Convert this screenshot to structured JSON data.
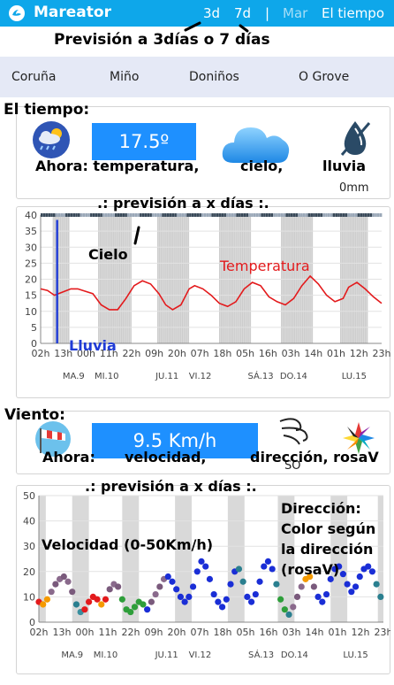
{
  "header": {
    "app_name": "Mareator",
    "nav": {
      "d3": "3d",
      "d7": "7d",
      "separator": "|",
      "mar": "Mar",
      "tiempo": "El tiempo"
    }
  },
  "annotations": {
    "forecast_note": "Previsión a 3días o 7 días",
    "weather_title": "El tiempo:",
    "weather_now": "Ahora: temperatura,",
    "weather_sky": "cielo,",
    "weather_rain": "lluvia",
    "forecast_days_1": ".: previsión a x días :.",
    "cielo": "Cielo",
    "temperatura": "Temperatura",
    "lluvia": "Lluvia",
    "wind_title": "Viento:",
    "wind_now": "Ahora:",
    "wind_speed": "velocidad,",
    "wind_dir": "dirección, rosaV",
    "forecast_days_2": ".: previsión a x días :.",
    "velocidad": "Velocidad (0-50Km/h)",
    "direccion_1": "Dirección:",
    "direccion_2": "Color según",
    "direccion_3": "la dirección",
    "direccion_4": "(rosaV)"
  },
  "locations": [
    "Coruña",
    "Miño",
    "Doniños",
    "O Grove"
  ],
  "weather_now": {
    "temperature": "17.5º",
    "rain": "0mm",
    "icons": [
      "partly-cloudy-rain-icon",
      "cloud-icon",
      "no-rain-drop-icon"
    ]
  },
  "wind_now": {
    "speed": "9.5 Km/h",
    "direction": "SO",
    "icons": [
      "windsock-icon",
      "wind-direction-icon",
      "wind-rose-icon"
    ]
  },
  "x_ticks": [
    "02h",
    "13h",
    "00h",
    "11h",
    "22h",
    "09h",
    "20h",
    "07h",
    "18h",
    "05h",
    "16h",
    "03h",
    "14h",
    "01h",
    "12h",
    "23h"
  ],
  "day_labels": [
    {
      "label": "MA.9",
      "at": 1.2
    },
    {
      "label": "MI.10",
      "at": 2.4
    },
    {
      "label": "JU.11",
      "at": 4.6
    },
    {
      "label": "VI.12",
      "at": 5.8
    },
    {
      "label": "SÁ.13",
      "at": 8.0
    },
    {
      "label": "DO.14",
      "at": 9.2
    },
    {
      "label": "LU.15",
      "at": 11.4
    }
  ],
  "colors": {
    "topbar": "#0ea7ea",
    "accent": "#1e90ff",
    "temperature": "#e31a1c",
    "rain": "#1f3bd6",
    "night_band": "#d9d9d9"
  },
  "chart_data": [
    {
      "type": "line",
      "title": "",
      "xlabel": "",
      "ylabel": "",
      "ylim": [
        0,
        40
      ],
      "yticks": [
        0,
        5,
        10,
        15,
        20,
        25,
        30,
        35,
        40
      ],
      "x_range": [
        0,
        12.4
      ],
      "night_bands": [
        [
          0.45,
          1.05
        ],
        [
          2.1,
          3.3
        ],
        [
          4.25,
          5.4
        ],
        [
          6.5,
          7.65
        ],
        [
          8.75,
          9.9
        ],
        [
          10.9,
          11.9
        ]
      ],
      "series": [
        {
          "name": "Temperatura",
          "x": [
            0,
            0.25,
            0.5,
            0.8,
            1.1,
            1.35,
            1.6,
            1.9,
            2.2,
            2.5,
            2.8,
            3.1,
            3.4,
            3.7,
            4.0,
            4.3,
            4.55,
            4.8,
            5.1,
            5.4,
            5.6,
            5.9,
            6.2,
            6.5,
            6.8,
            7.1,
            7.4,
            7.7,
            8.0,
            8.3,
            8.6,
            8.9,
            9.2,
            9.5,
            9.8,
            10.1,
            10.4,
            10.7,
            11.0,
            11.2,
            11.5,
            11.8,
            12.1,
            12.4
          ],
          "y": [
            17,
            16.5,
            15,
            16,
            17,
            17,
            16.3,
            15.5,
            12,
            10.5,
            10.5,
            14,
            18,
            19.5,
            18.5,
            15.5,
            12,
            10.5,
            12,
            17,
            18,
            17,
            15,
            12.5,
            11.5,
            13,
            17,
            19,
            18,
            14.5,
            13,
            12,
            14,
            18,
            21,
            18.5,
            15,
            13,
            14,
            17.5,
            19,
            17,
            14.5,
            12.5
          ]
        },
        {
          "name": "Lluvia",
          "x": [
            0.6
          ],
          "y": [
            38.5
          ]
        }
      ]
    },
    {
      "type": "scatter",
      "title": "",
      "xlabel": "",
      "ylabel": "",
      "ylim": [
        0,
        50
      ],
      "yticks": [
        0,
        10,
        20,
        30,
        40,
        50
      ],
      "x_range": [
        0,
        12.4
      ],
      "night_bands": [
        [
          0,
          0.25
        ],
        [
          1.2,
          1.8
        ],
        [
          3.0,
          3.6
        ],
        [
          4.9,
          5.5
        ],
        [
          6.8,
          7.4
        ],
        [
          8.6,
          9.2
        ],
        [
          10.5,
          11.1
        ],
        [
          12.2,
          12.4
        ]
      ],
      "series": [
        {
          "name": "Velocidad",
          "x": [
            0,
            0.15,
            0.3,
            0.45,
            0.6,
            0.75,
            0.9,
            1.05,
            1.2,
            1.35,
            1.5,
            1.65,
            1.8,
            1.95,
            2.1,
            2.25,
            2.4,
            2.55,
            2.7,
            2.85,
            3.0,
            3.15,
            3.3,
            3.45,
            3.6,
            3.75,
            3.9,
            4.05,
            4.2,
            4.35,
            4.5,
            4.65,
            4.8,
            4.95,
            5.1,
            5.25,
            5.4,
            5.55,
            5.7,
            5.85,
            6.0,
            6.15,
            6.3,
            6.45,
            6.6,
            6.75,
            6.9,
            7.05,
            7.2,
            7.35,
            7.5,
            7.65,
            7.8,
            7.95,
            8.1,
            8.25,
            8.4,
            8.55,
            8.7,
            8.85,
            9.0,
            9.15,
            9.3,
            9.45,
            9.6,
            9.75,
            9.9,
            10.05,
            10.2,
            10.35,
            10.5,
            10.65,
            10.8,
            10.95,
            11.1,
            11.25,
            11.4,
            11.55,
            11.7,
            11.85,
            12.0,
            12.15,
            12.3
          ],
          "y": [
            8,
            7,
            9,
            12,
            15,
            17,
            18,
            16,
            12,
            7,
            4,
            5,
            8,
            10,
            9,
            7,
            9,
            13,
            15,
            14,
            9,
            5,
            4,
            6,
            8,
            7,
            5,
            8,
            11,
            14,
            17,
            18,
            16,
            13,
            10,
            8,
            10,
            14,
            20,
            24,
            22,
            17,
            11,
            8,
            6,
            9,
            15,
            20,
            21,
            16,
            10,
            8,
            11,
            16,
            22,
            24,
            21,
            15,
            9,
            5,
            3,
            6,
            10,
            14,
            17,
            18,
            14,
            10,
            8,
            11,
            17,
            21,
            22,
            19,
            15,
            12,
            14,
            18,
            21,
            22,
            20,
            15,
            10
          ],
          "colors": [
            "#e31a1c",
            "#f59a00",
            "#f59a00",
            "#8a6a8c",
            "#7a5a7c",
            "#8a6a8c",
            "#7a5a7c",
            "#8a6a8c",
            "#7a5a7c",
            "#2a7f8f",
            "#3a8f9f",
            "#e31a1c",
            "#e31a1c",
            "#e31a1c",
            "#e31a1c",
            "#f59a00",
            "#e31a1c",
            "#7a5a7c",
            "#8a6a8c",
            "#7a5a7c",
            "#2e9e3a",
            "#2e9e3a",
            "#2e9e3a",
            "#2e9e3a",
            "#2e9e3a",
            "#2e9e3a",
            "#1a2ed6",
            "#7a5a7c",
            "#8a6a8c",
            "#7a5a7c",
            "#8a6a8c",
            "#1a2ed6",
            "#1a2ed6",
            "#1a2ed6",
            "#1a2ed6",
            "#1a2ed6",
            "#1a2ed6",
            "#1a2ed6",
            "#1a2ed6",
            "#1a2ed6",
            "#1a2ed6",
            "#1a2ed6",
            "#1a2ed6",
            "#1a2ed6",
            "#1a2ed6",
            "#1a2ed6",
            "#1a2ed6",
            "#1a2ed6",
            "#2a7f8f",
            "#2a7f8f",
            "#1a2ed6",
            "#1a2ed6",
            "#1a2ed6",
            "#1a2ed6",
            "#1a2ed6",
            "#1a2ed6",
            "#1a2ed6",
            "#2a7f8f",
            "#2e9e3a",
            "#2e9e3a",
            "#2a7f8f",
            "#8a6a8c",
            "#7a5a7c",
            "#8a6a8c",
            "#f59a00",
            "#f59a00",
            "#7a5a7c",
            "#1a2ed6",
            "#1a2ed6",
            "#1a2ed6",
            "#1a2ed6",
            "#1a2ed6",
            "#1a2ed6",
            "#1a2ed6",
            "#1a2ed6",
            "#1a2ed6",
            "#1a2ed6",
            "#1a2ed6",
            "#1a2ed6",
            "#1a2ed6",
            "#1a2ed6",
            "#2a7f8f",
            "#2a7f8f"
          ]
        }
      ]
    }
  ]
}
